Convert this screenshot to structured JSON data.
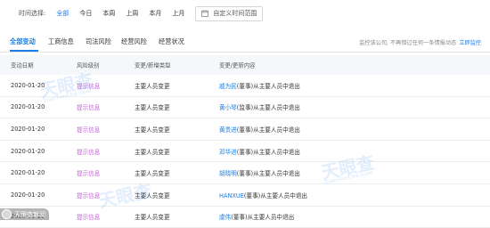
{
  "filter": {
    "label": "时间选择:",
    "options": [
      "全部",
      "今日",
      "本周",
      "上周",
      "本月",
      "上月"
    ],
    "active_index": 0,
    "custom_range": "自定义时间范围"
  },
  "tabs": {
    "items": [
      "全部变动",
      "工商信息",
      "司法风险",
      "经营风险",
      "经营状况"
    ],
    "active_index": 0,
    "hint": "监控该公司, 不再错过任何一条情报动态",
    "hint_link": "立即监控"
  },
  "table": {
    "headers": [
      "变动日期",
      "风险级别",
      "变更/新增类型",
      "变更/更新内容"
    ],
    "rows": [
      {
        "date": "2020-01-20",
        "risk": "提示信息",
        "type": "主要人员变更",
        "person": "戚为民",
        "rest": "(董事)从主要人员中退出"
      },
      {
        "date": "2020-01-20",
        "risk": "提示信息",
        "type": "主要人员变更",
        "person": "黄小琴",
        "rest": "(监事)从主要人员中退出"
      },
      {
        "date": "2020-01-20",
        "risk": "提示信息",
        "type": "主要人员变更",
        "person": "黄贵进",
        "rest": "(董事)从主要人员中退出"
      },
      {
        "date": "2020-01-20",
        "risk": "提示信息",
        "type": "主要人员变更",
        "person": "邓华进",
        "rest": "(董事)从主要人员中退出"
      },
      {
        "date": "2020-01-20",
        "risk": "提示信息",
        "type": "主要人员变更",
        "person": "胡晓明",
        "rest": "(董事)从主要人员中退出"
      },
      {
        "date": "2020-01-20",
        "risk": "提示信息",
        "type": "主要人员变更",
        "person": "HANXUE",
        "rest": "(董事)从主要人员中退出"
      },
      {
        "date": "2020-01-20",
        "risk": "提示信息",
        "type": "主要人员变更",
        "person": "虞伟",
        "rest": "(董事)从主要人员中退出"
      }
    ]
  },
  "watermark": {
    "brand": "天眼查",
    "domain": "TianYanCha.com",
    "footer": "天眼查新闻"
  }
}
